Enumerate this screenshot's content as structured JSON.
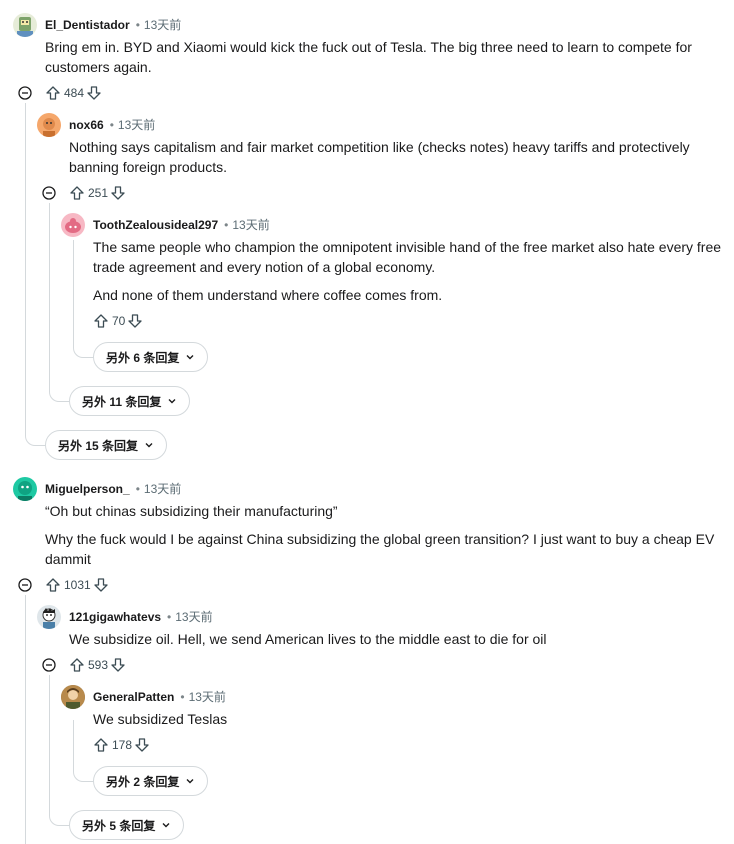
{
  "comments": [
    {
      "author": "El_Dentistador",
      "time": "13天前",
      "body": [
        "Bring em in. BYD and Xiaomi would kick the fuck out of Tesla. The big three need to learn to compete for customers again."
      ],
      "votes": "484"
    },
    {
      "author": "nox66",
      "time": "13天前",
      "body": [
        "Nothing says capitalism and fair market competition like (checks notes) heavy tariffs and protectively banning foreign products."
      ],
      "votes": "251"
    },
    {
      "author": "ToothZealousideal297",
      "time": "13天前",
      "body": [
        "The same people who champion the omnipotent invisible hand of the free market also hate every free trade agreement and every notion of a global economy.",
        "And none of them understand where coffee comes from."
      ],
      "votes": "70"
    },
    {
      "author": "Miguelperson_",
      "time": "13天前",
      "body": [
        "“Oh but chinas subsidizing their manufacturing”",
        "Why the fuck would I be against China subsidizing the global green transition? I just want to buy a cheap EV dammit"
      ],
      "votes": "1031"
    },
    {
      "author": "121gigawhatevs",
      "time": "13天前",
      "body": [
        "We subsidize oil. Hell, we send American lives to the middle east to die for oil"
      ],
      "votes": "593"
    },
    {
      "author": "GeneralPatten",
      "time": "13天前",
      "body": [
        "We subsidized Teslas"
      ],
      "votes": "178"
    }
  ],
  "more_replies": [
    "另外 6 条回复",
    "另外 11 条回复",
    "另外 15 条回复",
    "另外 2 条回复",
    "另外 5 条回复"
  ],
  "separator": "•",
  "colors": {
    "rail": "#d4d9dc",
    "text": "#1a1a1b",
    "meta": "#5c6c74"
  }
}
